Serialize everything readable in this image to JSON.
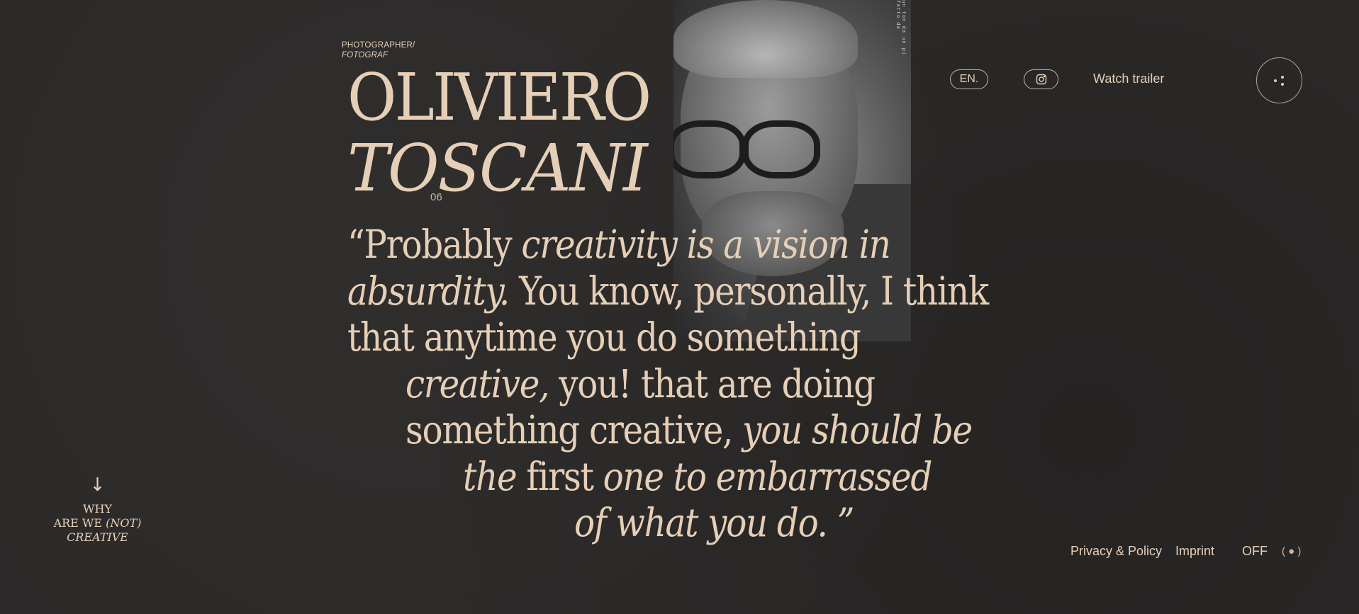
{
  "header": {
    "role_line1": "PHOTOGRAPHER/",
    "role_line2": "FOTOGRAF",
    "name_first": "OLIVIERO",
    "name_last": "TOSCANI",
    "number": "06",
    "lang_label": "EN.",
    "instagram_icon": "instagram-icon",
    "trailer_label": "Watch trailer",
    "menu_icon": "menu-dots-icon"
  },
  "photo": {
    "tape_text": "un ton da un pi fatto da"
  },
  "quote": {
    "open_mark": "“",
    "l1_a": "Probably ",
    "l1_b": "creativity is a vision in",
    "l2_a": "absurdity.",
    "l2_b": " You know, personally, I think",
    "l3": "that anytime you do something",
    "l4_a": "creative,",
    "l4_b": " you! that are doing",
    "l5_a": "something creative, ",
    "l5_b": "you should be",
    "l6_a": "the",
    "l6_b": " first ",
    "l6_c": "one to embarrassed",
    "l7": "of what you do.",
    "close_mark": " ”"
  },
  "scroll": {
    "arrow": "↓",
    "line1": "WHY",
    "line2_a": "ARE WE ",
    "line2_b": "(NOT)",
    "line3": "CREATIVE"
  },
  "footer": {
    "privacy": "Privacy & Policy",
    "imprint": "Imprint",
    "sound": "OFF",
    "toggle": "( ● )"
  },
  "colors": {
    "background": "#2c2a29",
    "accent": "#e6cfb7"
  }
}
